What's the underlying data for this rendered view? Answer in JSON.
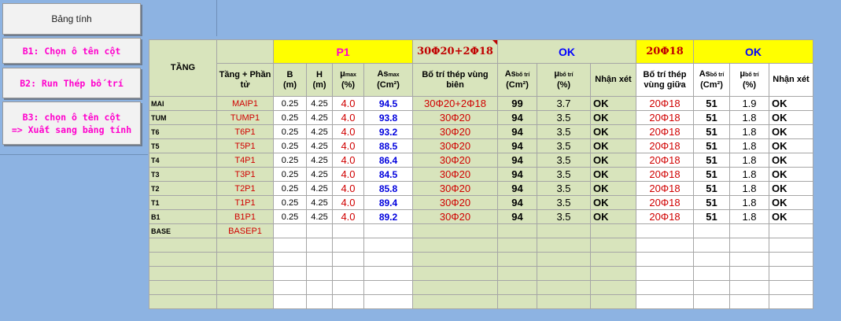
{
  "buttons": {
    "sheet": "Bảng tính",
    "b1": "B1: Chọn ô tên cột",
    "b2": "B2: Run Thép bố trí",
    "b3_line1": "B3: chọn ô tên cột",
    "b3_line2": "=> Xuất sang bảng tính"
  },
  "table": {
    "tang": "TẦNG",
    "p1": "P1",
    "top_bien": "30Φ20+2Φ18",
    "ok_bien": "OK",
    "top_giua": "20Φ18",
    "ok_giua": "OK",
    "headers": {
      "tang_phan_tu": "Tầng + Phần tử",
      "b": "B",
      "b_unit": "(m)",
      "h": "H",
      "h_unit": "(m)",
      "mu": "μ",
      "mu_sub": "max",
      "mu_unit": "(%)",
      "as": "As",
      "as_sub": "max",
      "as_unit": "(Cm²)",
      "bo_tri_bien": "Bố trí thép vùng biên",
      "as_bt": "As",
      "as_bt_sub": "bố trí",
      "as_bt_unit": "(Cm²)",
      "mu_bt": "μ",
      "mu_bt_sub": "bố trí",
      "mu_bt_unit": "(%)",
      "nhan_xet": "Nhận xét",
      "bo_tri_giua": "Bố trí thép vùng giữa"
    },
    "rows": [
      {
        "floor": "MAI",
        "el": "MAIP1",
        "b": "0.25",
        "h": "4.25",
        "mu": "4.0",
        "as": "94.5",
        "bien": "30Φ20+2Φ18",
        "asb": "99",
        "mub": "3.7",
        "nx1": "OK",
        "giua": "20Φ18",
        "asg": "51",
        "mug": "1.9",
        "nx2": "OK"
      },
      {
        "floor": "TUM",
        "el": "TUMP1",
        "b": "0.25",
        "h": "4.25",
        "mu": "4.0",
        "as": "93.8",
        "bien": "30Φ20",
        "asb": "94",
        "mub": "3.5",
        "nx1": "OK",
        "giua": "20Φ18",
        "asg": "51",
        "mug": "1.8",
        "nx2": "OK"
      },
      {
        "floor": "T6",
        "el": "T6P1",
        "b": "0.25",
        "h": "4.25",
        "mu": "4.0",
        "as": "93.2",
        "bien": "30Φ20",
        "asb": "94",
        "mub": "3.5",
        "nx1": "OK",
        "giua": "20Φ18",
        "asg": "51",
        "mug": "1.8",
        "nx2": "OK"
      },
      {
        "floor": "T5",
        "el": "T5P1",
        "b": "0.25",
        "h": "4.25",
        "mu": "4.0",
        "as": "88.5",
        "bien": "30Φ20",
        "asb": "94",
        "mub": "3.5",
        "nx1": "OK",
        "giua": "20Φ18",
        "asg": "51",
        "mug": "1.8",
        "nx2": "OK"
      },
      {
        "floor": "T4",
        "el": "T4P1",
        "b": "0.25",
        "h": "4.25",
        "mu": "4.0",
        "as": "86.4",
        "bien": "30Φ20",
        "asb": "94",
        "mub": "3.5",
        "nx1": "OK",
        "giua": "20Φ18",
        "asg": "51",
        "mug": "1.8",
        "nx2": "OK"
      },
      {
        "floor": "T3",
        "el": "T3P1",
        "b": "0.25",
        "h": "4.25",
        "mu": "4.0",
        "as": "84.5",
        "bien": "30Φ20",
        "asb": "94",
        "mub": "3.5",
        "nx1": "OK",
        "giua": "20Φ18",
        "asg": "51",
        "mug": "1.8",
        "nx2": "OK"
      },
      {
        "floor": "T2",
        "el": "T2P1",
        "b": "0.25",
        "h": "4.25",
        "mu": "4.0",
        "as": "85.8",
        "bien": "30Φ20",
        "asb": "94",
        "mub": "3.5",
        "nx1": "OK",
        "giua": "20Φ18",
        "asg": "51",
        "mug": "1.8",
        "nx2": "OK"
      },
      {
        "floor": "T1",
        "el": "T1P1",
        "b": "0.25",
        "h": "4.25",
        "mu": "4.0",
        "as": "89.4",
        "bien": "30Φ20",
        "asb": "94",
        "mub": "3.5",
        "nx1": "OK",
        "giua": "20Φ18",
        "asg": "51",
        "mug": "1.8",
        "nx2": "OK"
      },
      {
        "floor": "B1",
        "el": "B1P1",
        "b": "0.25",
        "h": "4.25",
        "mu": "4.0",
        "as": "89.2",
        "bien": "30Φ20",
        "asb": "94",
        "mub": "3.5",
        "nx1": "OK",
        "giua": "20Φ18",
        "asg": "51",
        "mug": "1.8",
        "nx2": "OK"
      },
      {
        "floor": "BASE",
        "el": "BASEP1",
        "b": "",
        "h": "",
        "mu": "",
        "as": "",
        "bien": "",
        "asb": "",
        "mub": "",
        "nx1": "",
        "giua": "",
        "asg": "",
        "mug": "",
        "nx2": ""
      },
      {
        "floor": "",
        "el": "",
        "b": "",
        "h": "",
        "mu": "",
        "as": "",
        "bien": "",
        "asb": "",
        "mub": "",
        "nx1": "",
        "giua": "",
        "asg": "",
        "mug": "",
        "nx2": ""
      },
      {
        "floor": "",
        "el": "",
        "b": "",
        "h": "",
        "mu": "",
        "as": "",
        "bien": "",
        "asb": "",
        "mub": "",
        "nx1": "",
        "giua": "",
        "asg": "",
        "mug": "",
        "nx2": ""
      },
      {
        "floor": "",
        "el": "",
        "b": "",
        "h": "",
        "mu": "",
        "as": "",
        "bien": "",
        "asb": "",
        "mub": "",
        "nx1": "",
        "giua": "",
        "asg": "",
        "mug": "",
        "nx2": ""
      },
      {
        "floor": "",
        "el": "",
        "b": "",
        "h": "",
        "mu": "",
        "as": "",
        "bien": "",
        "asb": "",
        "mub": "",
        "nx1": "",
        "giua": "",
        "asg": "",
        "mug": "",
        "nx2": ""
      },
      {
        "floor": "",
        "el": "",
        "b": "",
        "h": "",
        "mu": "",
        "as": "",
        "bien": "",
        "asb": "",
        "mub": "",
        "nx1": "",
        "giua": "",
        "asg": "",
        "mug": "",
        "nx2": ""
      }
    ]
  }
}
